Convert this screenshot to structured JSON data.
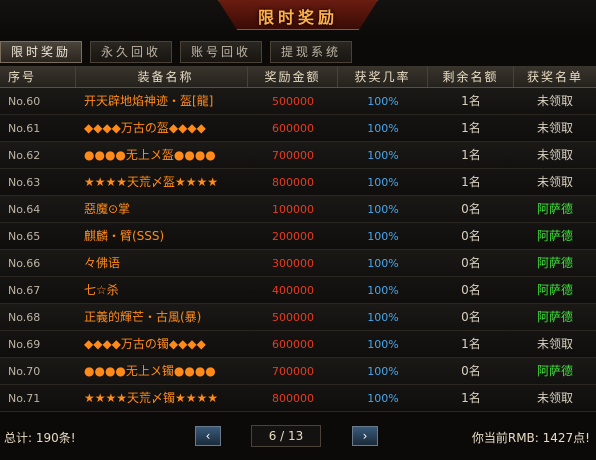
{
  "banner": {
    "title": "限时奖励"
  },
  "tabs": [
    {
      "label": "限时奖励",
      "active": true
    },
    {
      "label": "永久回收",
      "active": false
    },
    {
      "label": "账号回收",
      "active": false
    },
    {
      "label": "提现系统",
      "active": false
    }
  ],
  "table": {
    "headers": [
      "序号",
      "装备名称",
      "奖励金额",
      "获奖几率",
      "剩余名额",
      "获奖名单"
    ],
    "rows": [
      {
        "no": "No.60",
        "name": "开天辟地焰神迹・盔[龍]",
        "amount": "500000",
        "rate": "100%",
        "remaining": "1名",
        "winner": "未领取",
        "claimed": false
      },
      {
        "no": "No.61",
        "name": "◆◆◆◆万古の盔◆◆◆◆",
        "amount": "600000",
        "rate": "100%",
        "remaining": "1名",
        "winner": "未领取",
        "claimed": false
      },
      {
        "no": "No.62",
        "name": "●●●●无上〤盔●●●●",
        "amount": "700000",
        "rate": "100%",
        "remaining": "1名",
        "winner": "未领取",
        "claimed": false
      },
      {
        "no": "No.63",
        "name": "★★★★天荒〆盔★★★★",
        "amount": "800000",
        "rate": "100%",
        "remaining": "1名",
        "winner": "未领取",
        "claimed": false
      },
      {
        "no": "No.64",
        "name": "惡魔⊙掌",
        "amount": "100000",
        "rate": "100%",
        "remaining": "0名",
        "winner": "阿萨德",
        "claimed": true
      },
      {
        "no": "No.65",
        "name": "麒麟・臂(SSS)",
        "amount": "200000",
        "rate": "100%",
        "remaining": "0名",
        "winner": "阿萨德",
        "claimed": true
      },
      {
        "no": "No.66",
        "name": "々佛语",
        "amount": "300000",
        "rate": "100%",
        "remaining": "0名",
        "winner": "阿萨德",
        "claimed": true
      },
      {
        "no": "No.67",
        "name": "七☆杀",
        "amount": "400000",
        "rate": "100%",
        "remaining": "0名",
        "winner": "阿萨德",
        "claimed": true
      },
      {
        "no": "No.68",
        "name": "正義的輝芒・古風(暴)",
        "amount": "500000",
        "rate": "100%",
        "remaining": "0名",
        "winner": "阿萨德",
        "claimed": true
      },
      {
        "no": "No.69",
        "name": "◆◆◆◆万古の镯◆◆◆◆",
        "amount": "600000",
        "rate": "100%",
        "remaining": "1名",
        "winner": "未领取",
        "claimed": false
      },
      {
        "no": "No.70",
        "name": "●●●●无上〤镯●●●●",
        "amount": "700000",
        "rate": "100%",
        "remaining": "0名",
        "winner": "阿萨德",
        "claimed": true
      },
      {
        "no": "No.71",
        "name": "★★★★天荒〆镯★★★★",
        "amount": "800000",
        "rate": "100%",
        "remaining": "1名",
        "winner": "未领取",
        "claimed": false
      }
    ]
  },
  "footer": {
    "total": "总计: 190条!",
    "prev": "‹",
    "next": "›",
    "page": "6 / 13",
    "balance": "你当前RMB: 1427点!"
  },
  "colors": {
    "winner_claimed": "#3ee23a",
    "winner_unclaimed": "#d8d0c0"
  }
}
